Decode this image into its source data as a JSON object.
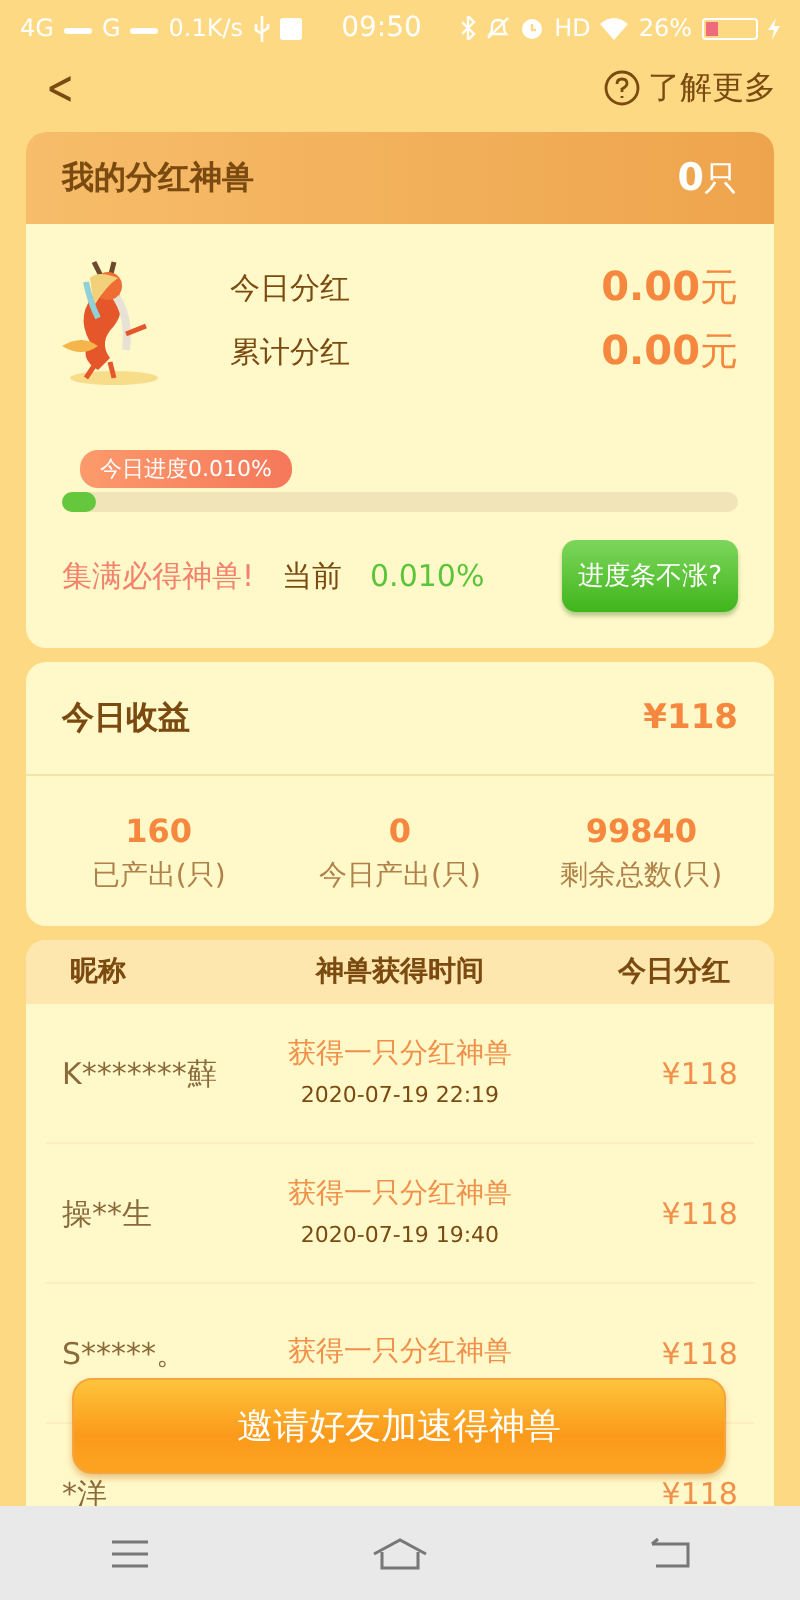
{
  "status_bar": {
    "network": "4G",
    "network_2": "G",
    "speed": "0.1K/s",
    "time": "09:50",
    "hd": "HD",
    "battery": "26%"
  },
  "nav": {
    "back": "<",
    "help": "了解更多"
  },
  "beast_card": {
    "title": "我的分红神兽",
    "count_value": "0",
    "count_unit": "只",
    "stats": [
      {
        "label": "今日分红",
        "value": "0.00",
        "unit": "元"
      },
      {
        "label": "累计分红",
        "value": "0.00",
        "unit": "元"
      }
    ],
    "progress_tip": "今日进度0.010%",
    "level": 0.05,
    "slogan": "集满必得神兽!",
    "current_label": "当前",
    "current_value": "0.010%",
    "button": "进度条不涨?"
  },
  "income_card": {
    "title": "今日收益",
    "amount": "¥118",
    "stats": [
      {
        "value": "160",
        "label": "已产出(只)"
      },
      {
        "value": "0",
        "label": "今日产出(只)"
      },
      {
        "value": "99840",
        "label": "剩余总数(只)"
      }
    ]
  },
  "table": {
    "columns": [
      "昵称",
      "神兽获得时间",
      "今日分红"
    ],
    "rows": [
      {
        "name": "K*******蘚",
        "event": "获得一只分红神兽",
        "time": "2020-07-19 22:19",
        "amount": "¥118"
      },
      {
        "name": "操**生",
        "event": "获得一只分红神兽",
        "time": "2020-07-19 19:40",
        "amount": "¥118"
      },
      {
        "name": "S*****。",
        "event": "获得一只分红神兽",
        "amount": "¥118"
      },
      {
        "name": "*洋",
        "amount": "¥118"
      }
    ]
  },
  "invite_button": "邀请好友加速得神兽"
}
